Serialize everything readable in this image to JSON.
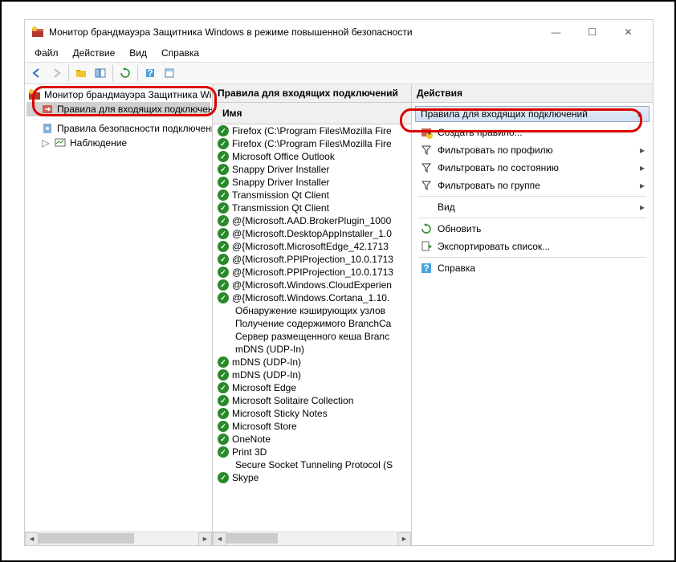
{
  "window": {
    "title": "Монитор брандмауэра Защитника Windows в режиме повышенной безопасности"
  },
  "menu": {
    "file": "Файл",
    "action": "Действие",
    "view": "Вид",
    "help": "Справка"
  },
  "tree": {
    "root": "Монитор брандмауэра Защитника Window",
    "inbound": "Правила для входящих подключений",
    "security": "Правила безопасности подключения",
    "monitor": "Наблюдение"
  },
  "rules_panel": {
    "title": "Правила для входящих подключений",
    "col_name": "Имя"
  },
  "rules": [
    {
      "name": "Firefox (C:\\Program Files\\Mozilla Fire"
    },
    {
      "name": "Firefox (C:\\Program Files\\Mozilla Fire"
    },
    {
      "name": "Microsoft Office Outlook"
    },
    {
      "name": "Snappy Driver Installer"
    },
    {
      "name": "Snappy Driver Installer"
    },
    {
      "name": "Transmission Qt Client"
    },
    {
      "name": "Transmission Qt Client"
    },
    {
      "name": "@{Microsoft.AAD.BrokerPlugin_1000"
    },
    {
      "name": "@{Microsoft.DesktopAppInstaller_1.0"
    },
    {
      "name": "@{Microsoft.MicrosoftEdge_42.1713"
    },
    {
      "name": "@{Microsoft.PPIProjection_10.0.1713"
    },
    {
      "name": "@{Microsoft.PPIProjection_10.0.1713"
    },
    {
      "name": "@{Microsoft.Windows.CloudExperien"
    },
    {
      "name": "@{Microsoft.Windows.Cortana_1.10."
    }
  ],
  "rules_noicon": [
    {
      "name": "Обнаружение кэширующих узлов"
    },
    {
      "name": "Получение содержимого BranchCa"
    },
    {
      "name": "Сервер размещенного кеша Branc"
    },
    {
      "name": "mDNS (UDP-In)"
    }
  ],
  "rules2": [
    {
      "name": "mDNS (UDP-In)"
    },
    {
      "name": "mDNS (UDP-In)"
    },
    {
      "name": "Microsoft Edge"
    },
    {
      "name": "Microsoft Solitaire Collection"
    },
    {
      "name": "Microsoft Sticky Notes"
    },
    {
      "name": "Microsoft Store"
    },
    {
      "name": "OneNote"
    },
    {
      "name": "Print 3D"
    }
  ],
  "rules_noicon2": [
    {
      "name": "Secure Socket Tunneling Protocol (S"
    }
  ],
  "rules3": [
    {
      "name": "Skype"
    }
  ],
  "actions_panel": {
    "title": "Действия",
    "sub": "Правила для входящих подключений"
  },
  "actions": {
    "create": "Создать правило...",
    "filter_profile": "Фильтровать по профилю",
    "filter_state": "Фильтровать по состоянию",
    "filter_group": "Фильтровать по группе",
    "view": "Вид",
    "refresh": "Обновить",
    "export": "Экспортировать список...",
    "help": "Справка"
  }
}
